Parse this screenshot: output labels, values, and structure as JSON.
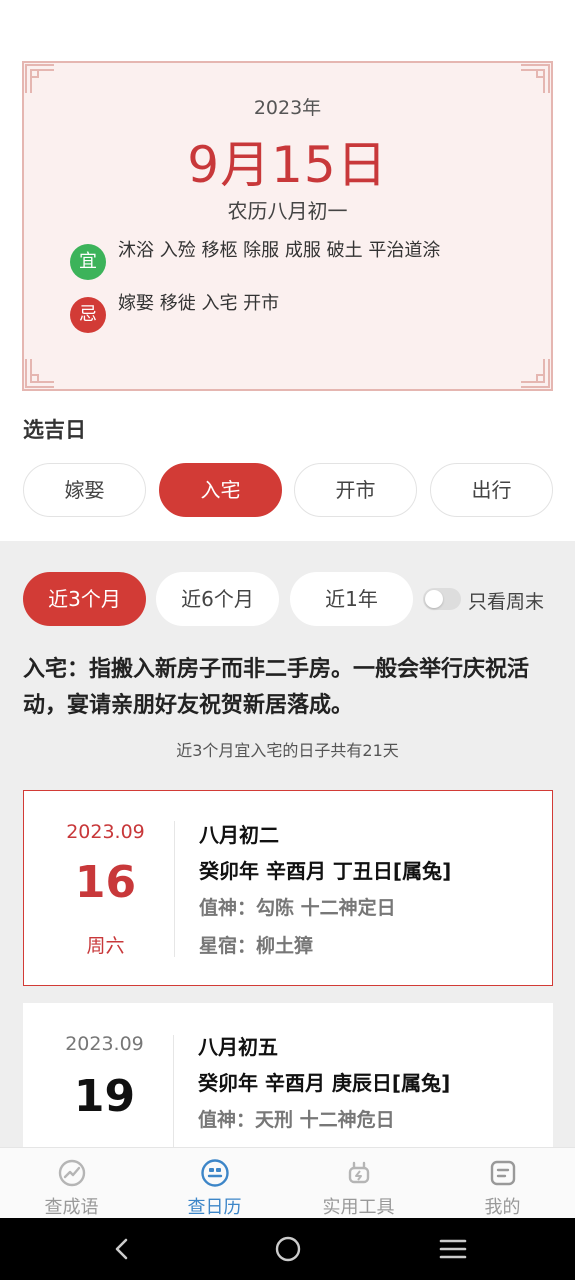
{
  "card": {
    "year": "2023年",
    "date": "9月15日",
    "lunar": "农历八月初一",
    "yi_badge": "宜",
    "yi_text": "沐浴 入殓 移柩 除服 成服 破土 平治道涂",
    "ji_badge": "忌",
    "ji_text": "嫁娶 移徙 入宅 开市"
  },
  "select_title": "选吉日",
  "categories": [
    {
      "label": "嫁娶",
      "active": false
    },
    {
      "label": "入宅",
      "active": true
    },
    {
      "label": "开市",
      "active": false
    },
    {
      "label": "出行",
      "active": false
    }
  ],
  "ranges": [
    {
      "label": "近3个月",
      "active": true
    },
    {
      "label": "近6个月",
      "active": false
    },
    {
      "label": "近1年",
      "active": false
    }
  ],
  "weekend_toggle": {
    "label": "只看周末",
    "on": false
  },
  "description": "入宅：指搬入新房子而非二手房。一般会举行庆祝活动，宴请亲朋好友祝贺新居落成。",
  "count_text": "近3个月宜入宅的日子共有21天",
  "days": [
    {
      "ym": "2023.09",
      "day": "16",
      "weekday": "周六",
      "lunar": "八月初二",
      "ganzhi": "癸卯年 辛酉月 丁丑日[属兔]",
      "zhishen": "值神：勾陈   十二神定日",
      "xingxiu": "星宿：柳土獐"
    },
    {
      "ym": "2023.09",
      "day": "19",
      "lunar": "八月初五",
      "ganzhi": "癸卯年 辛酉月 庚辰日[属兔]",
      "zhishen": "值神：天刑   十二神危日"
    }
  ],
  "nav": [
    {
      "label": "查成语",
      "icon": "idiom-icon",
      "active": false
    },
    {
      "label": "查日历",
      "icon": "calendar-icon",
      "active": true
    },
    {
      "label": "实用工具",
      "icon": "tools-icon",
      "active": false
    },
    {
      "label": "我的",
      "icon": "profile-icon",
      "active": false
    }
  ],
  "colors": {
    "accent_red": "#d23b36",
    "yi_green": "#3cb35a",
    "nav_active": "#3d86c8"
  }
}
